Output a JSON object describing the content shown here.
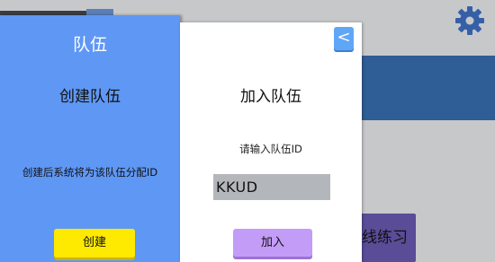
{
  "settings_icon": "gear-icon",
  "background": {
    "practice_button_label": "线练习"
  },
  "create_panel": {
    "title": "队伍",
    "heading": "创建队伍",
    "description": "创建后系统将为该队伍分配ID",
    "create_button_label": "创建"
  },
  "join_panel": {
    "back_icon": "<",
    "heading": "加入队伍",
    "prompt": "请输入队伍ID",
    "team_id_value": "KKUD",
    "join_button_label": "加入"
  },
  "colors": {
    "create_panel_bg": "#5f97f4",
    "create_button": "#fee900",
    "join_button": "#c39cf7",
    "back_button": "#60a6f7"
  }
}
